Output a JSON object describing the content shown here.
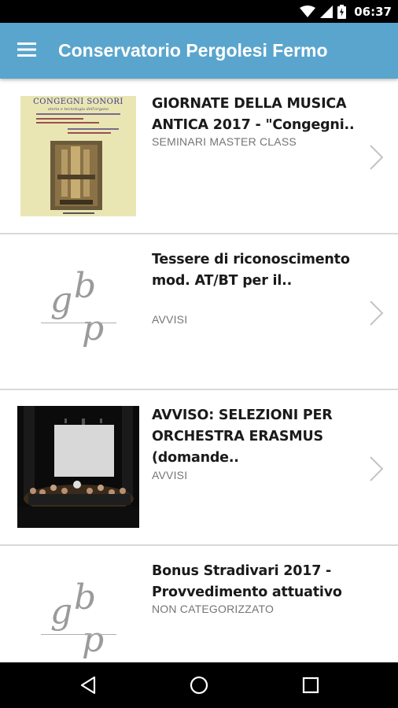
{
  "status_bar": {
    "time": "06:37",
    "icons": [
      "wifi-icon",
      "signal-icon",
      "battery-icon"
    ]
  },
  "app_bar": {
    "menu_icon": "hamburger-menu-icon",
    "title": "Conservatorio Pergolesi Fermo"
  },
  "items": [
    {
      "title": "GIORNATE DELLA MUSICA ANTICA 2017 - \"Congegni..",
      "category": "SEMINARI MASTER CLASS",
      "thumbnail": "congegni-sonori-poster",
      "poster_text": {
        "title": "CONGEGNI SONORI",
        "subtitle": "storia e tecnologia dell'organo"
      }
    },
    {
      "title": "Tessere di riconosci­mento mod. AT/BT per il..",
      "category": "AVVISI",
      "thumbnail": "gbp-logo"
    },
    {
      "title": "AVVISO: SELEZIONI PER ORCHESTRA ERASMUS (domande..",
      "category": "AVVISI",
      "thumbnail": "orchestra-photo"
    },
    {
      "title": "Bonus Stradivari 2017 - Provvedimento attuativo",
      "category": "NON CATEGORIZZATO",
      "thumbnail": "gbp-logo"
    }
  ],
  "logo_letters": {
    "g": "g",
    "b": "b",
    "p": "p"
  },
  "nav_bar": {
    "icons": [
      "back-icon",
      "home-icon",
      "recents-icon"
    ]
  },
  "colors": {
    "app_bar": "#5aa5cd",
    "status_bar": "#000000",
    "title_text": "#1a1a1a",
    "category_text": "#757575"
  }
}
